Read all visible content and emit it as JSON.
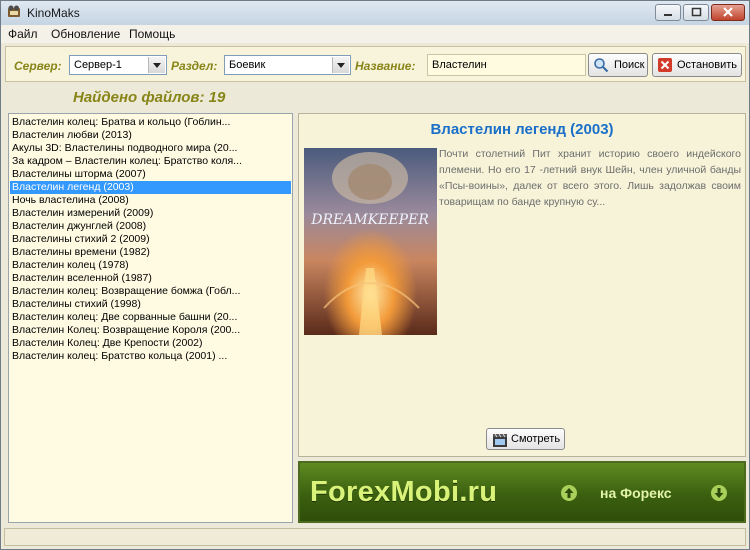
{
  "window": {
    "title": "KinoMaks"
  },
  "menu": {
    "items": [
      "Файл",
      "Обновление",
      "Помощь"
    ]
  },
  "filters": {
    "server_label": "Сервер:",
    "server_value": "Сервер-1",
    "section_label": "Раздел:",
    "section_value": "Боевик",
    "name_label": "Название:",
    "name_value": "Властелин",
    "search_button": "Поиск",
    "stop_button": "Остановить"
  },
  "results": {
    "found_text": "Найдено файлов: 19",
    "selected_index": 5,
    "items": [
      "Властелин колец: Братва и кольцо (Гоблин...",
      "Властелин любви (2013)",
      "Акулы 3D: Властелины подводного мира (20...",
      "За кадром – Властелин колец: Братство коля...",
      "Властелины шторма (2007)",
      "Властелин легенд (2003)",
      "Ночь властелина (2008)",
      "Властелин измерений (2009)",
      "Властелин джунглей (2008)",
      "Властелины стихий 2 (2009)",
      "Властелины времени (1982)",
      "Властелин колец (1978)",
      "Властелин вселенной (1987)",
      "Властелин колец: Возвращение бомжа (Гобл...",
      "Властелины стихий (1998)",
      "Властелин колец: Две сорванные башни (20...",
      "Властелин Колец: Возвращение Короля (200...",
      "Властелин Колец: Две Крепости (2002)",
      "Властелин колец: Братство кольца (2001) ..."
    ]
  },
  "details": {
    "title": "Властелин легенд (2003)",
    "poster_text": "DREAMKEEPER",
    "description": "Почти столетний Пит хранит историю своего индейского племени. Но его 17 -летний внук Шейн, член уличной банды «Псы-воины», далек от всего этого. Лишь задолжав своим товарищам по банде крупную су...",
    "watch_button": "Смотреть"
  },
  "banner": {
    "main_text": "ForexMobi.ru",
    "sub_text": "на Форекс"
  },
  "colors": {
    "accent_label": "#888518",
    "title_blue": "#1a6fc9",
    "selection": "#3399ff"
  }
}
